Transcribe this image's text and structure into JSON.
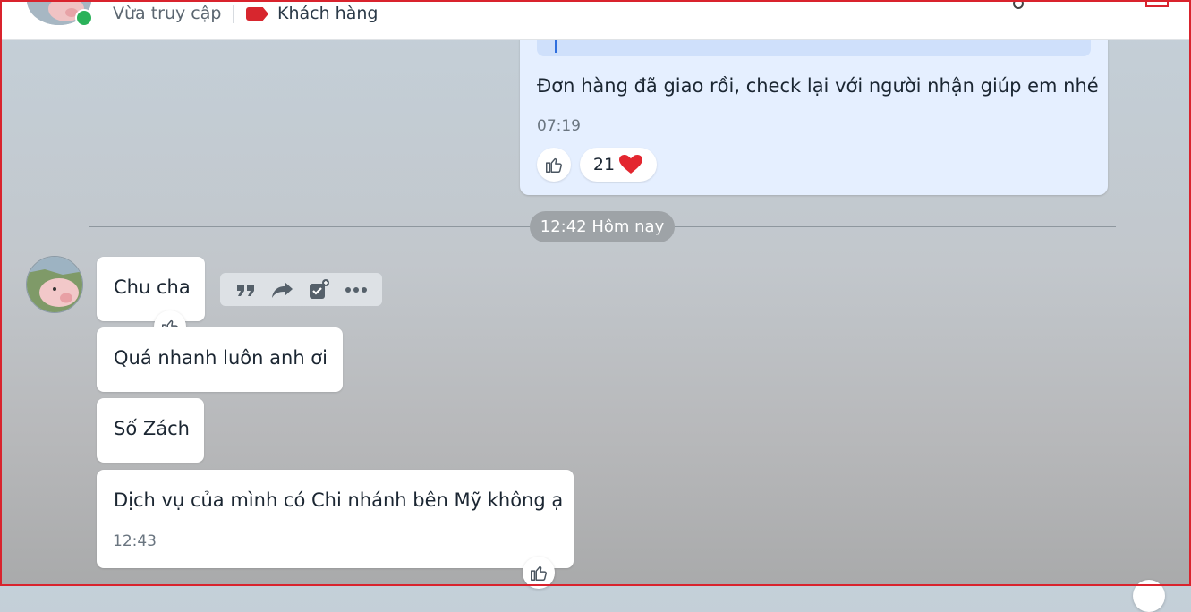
{
  "header": {
    "status_text": "Vừa truy cập",
    "tag_label": "Khách hàng",
    "tag_color": "#d7262e",
    "online_color": "#2bb25a"
  },
  "sent_message": {
    "text": "Đơn hàng đã giao rồi, check lại với người nhận giúp em nhé",
    "time": "07:19",
    "reaction_count": "21",
    "reaction_icon": "heart-icon"
  },
  "divider": {
    "label": "12:42 Hôm nay"
  },
  "messages": [
    {
      "text": "Chu cha"
    },
    {
      "text": "Quá nhanh luôn anh ơi"
    },
    {
      "text": "Số Zách"
    },
    {
      "text": "Dịch vụ của mình có Chi nhánh bên Mỹ không ạ",
      "time": "12:43"
    }
  ],
  "message_toolbar": [
    "quote-icon",
    "forward-icon",
    "add-task-icon",
    "more-icon"
  ],
  "colors": {
    "sent_bubble": "#e5efff",
    "accent": "#2f6fde",
    "like_icon": "#4a5560"
  }
}
